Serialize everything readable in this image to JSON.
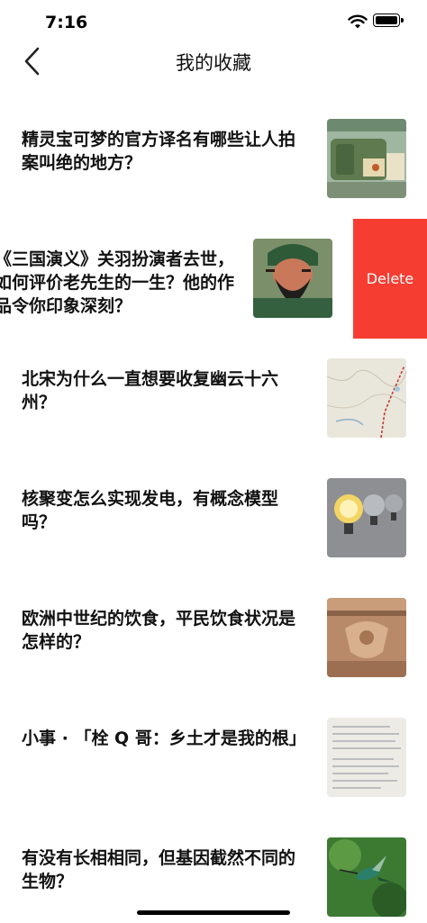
{
  "status": {
    "time": "7:16"
  },
  "nav": {
    "title": "我的收藏"
  },
  "items": [
    {
      "title": "精灵宝可梦的官方译名有哪些让人拍案叫绝的地方？",
      "thumb": "bag-image"
    },
    {
      "title": "《三国演义》关羽扮演者去世，如何评价老先生的一生？他的作品令你印象深刻？",
      "thumb": "guan-yu-portrait"
    },
    {
      "title": "北宋为什么一直想要收复幽云十六州？",
      "thumb": "map-image"
    },
    {
      "title": "核聚变怎么实现发电，有概念模型吗？",
      "thumb": "lightbulbs-image"
    },
    {
      "title": "欧洲中世纪的饮食，平民饮食状况是怎样的？",
      "thumb": "stone-carving-image"
    },
    {
      "title": "小事 · 「栓 Q 哥：乡土才是我的根」",
      "thumb": "handwritten-letter-image"
    },
    {
      "title": "有没有长相相同，但基因截然不同的生物？",
      "thumb": "hummingbird-image"
    }
  ],
  "swipe": {
    "delete_label": "Delete"
  },
  "colors": {
    "delete": "#f53d32"
  }
}
